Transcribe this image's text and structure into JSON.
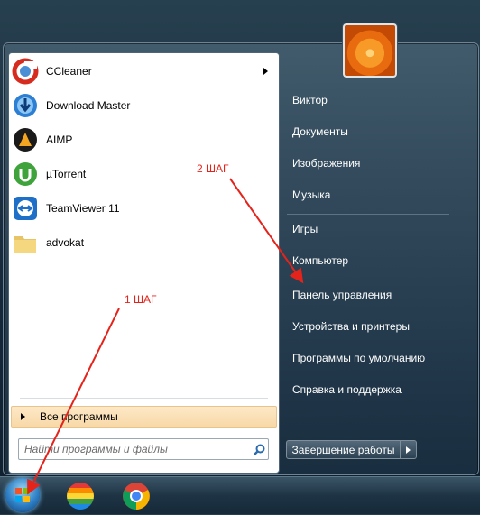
{
  "programs": [
    {
      "label": "CCleaner",
      "icon": "ccleaner-icon",
      "has_submenu": true
    },
    {
      "label": "Download Master",
      "icon": "download-master-icon",
      "has_submenu": false
    },
    {
      "label": "AIMP",
      "icon": "aimp-icon",
      "has_submenu": false
    },
    {
      "label": "µTorrent",
      "icon": "utorrent-icon",
      "has_submenu": false
    },
    {
      "label": "TeamViewer 11",
      "icon": "teamviewer-icon",
      "has_submenu": false
    },
    {
      "label": "advokat",
      "icon": "folder-icon",
      "has_submenu": false
    }
  ],
  "all_programs": "Все программы",
  "search": {
    "placeholder": "Найти программы и файлы"
  },
  "right_menu": [
    "Виктор",
    "Документы",
    "Изображения",
    "Музыка",
    "Игры",
    "Компьютер",
    "Панель управления",
    "Устройства и принтеры",
    "Программы по умолчанию",
    "Справка и поддержка"
  ],
  "shutdown_label": "Завершение работы",
  "annotations": {
    "step1": "1 ШАГ",
    "step2": "2 ШАГ"
  },
  "colors": {
    "annotation": "#e4231b",
    "highlight": "#f8d9a8"
  }
}
